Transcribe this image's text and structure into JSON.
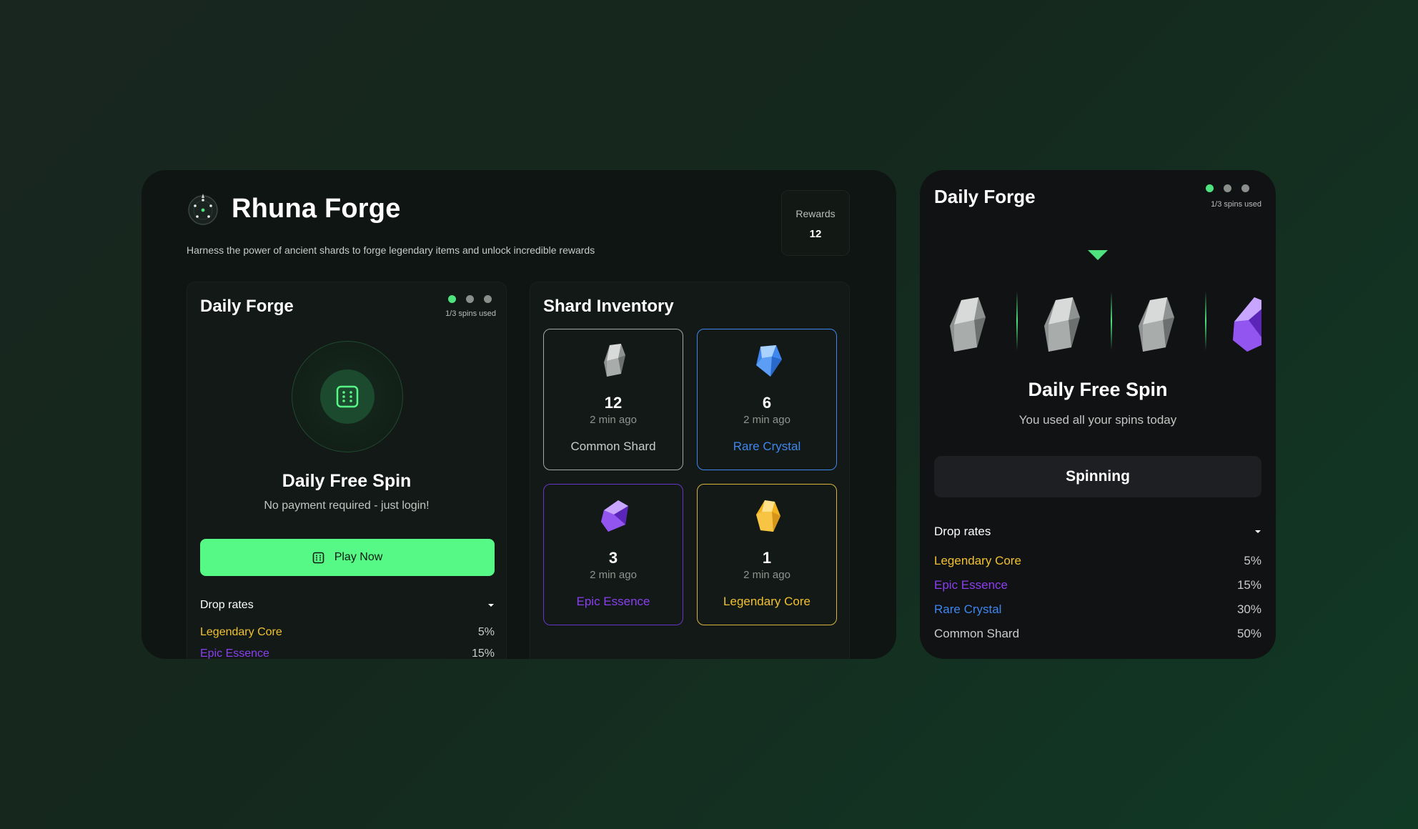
{
  "app": {
    "title": "Rhuna Forge",
    "subtitle": "Harness the power of ancient shards to forge legendary items and unlock incredible rewards",
    "rewards_label": "Rewards",
    "rewards_value": "12"
  },
  "daily_forge": {
    "title": "Daily Forge",
    "spins_used": "1/3 spins used",
    "spin_title": "Daily Free Spin",
    "spin_subtitle": "No payment required - just login!",
    "play_label": "Play Now",
    "drop_rates_label": "Drop rates",
    "drop_rates": [
      {
        "name": "Legendary Core",
        "rate": "5%",
        "color": "#f2c12e"
      },
      {
        "name": "Epic Essence",
        "rate": "15%",
        "color": "#8a3ff0"
      }
    ]
  },
  "inventory": {
    "title": "Shard Inventory",
    "items": [
      {
        "count": "12",
        "time": "2 min ago",
        "name": "Common Shard",
        "color": "#c9ccca",
        "border": "#a3a7a5",
        "icon": "common-shard-icon"
      },
      {
        "count": "6",
        "time": "2 min ago",
        "name": "Rare Crystal",
        "color": "#3f86ee",
        "border": "#3f86ee",
        "icon": "rare-crystal-icon"
      },
      {
        "count": "3",
        "time": "2 min ago",
        "name": "Epic Essence",
        "color": "#8a3ff0",
        "border": "#6a34c9",
        "icon": "epic-essence-icon"
      },
      {
        "count": "1",
        "time": "2 min ago",
        "name": "Legendary Core",
        "color": "#f2c12e",
        "border": "#d9b43c",
        "icon": "legendary-core-icon"
      }
    ]
  },
  "side": {
    "title": "Daily Forge",
    "spins_used": "1/3 spins used",
    "spin_title": "Daily Free Spin",
    "spin_subtitle": "You used all your spins today",
    "button_label": "Spinning",
    "drop_rates_label": "Drop rates",
    "drop_rates": [
      {
        "name": "Legendary Core",
        "rate": "5%",
        "color": "#f2c12e"
      },
      {
        "name": "Epic Essence",
        "rate": "15%",
        "color": "#8a3ff0"
      },
      {
        "name": "Rare Crystal",
        "rate": "30%",
        "color": "#3f86ee"
      },
      {
        "name": "Common Shard",
        "rate": "50%",
        "color": "#c9ccca"
      }
    ]
  },
  "colors": {
    "accent": "#56f986",
    "dot_active": "#4ee37f",
    "dot_inactive": "#8a8f8c"
  }
}
